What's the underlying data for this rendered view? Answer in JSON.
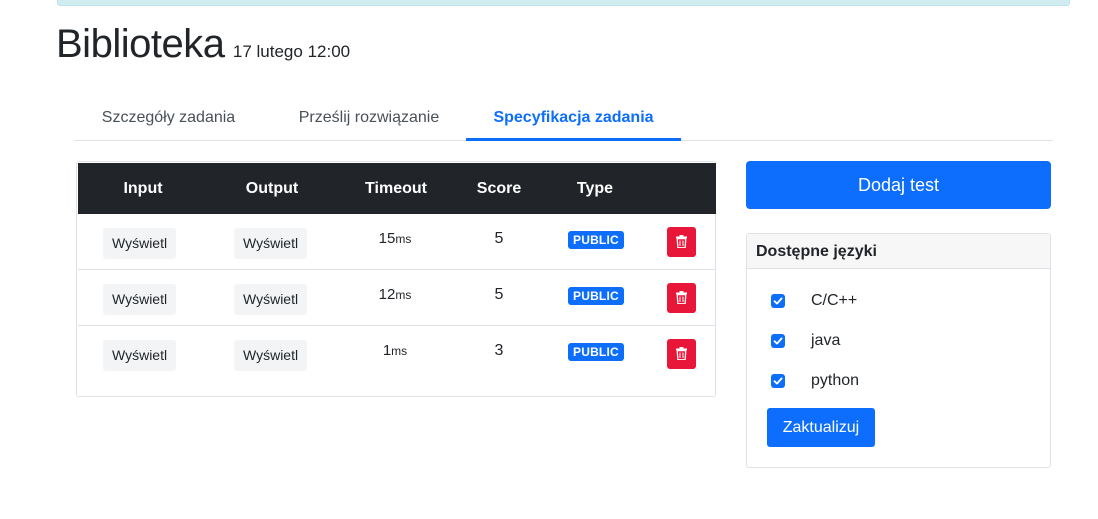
{
  "header": {
    "title": "Biblioteka",
    "date": "17 lutego 12:00"
  },
  "tabs": [
    {
      "label": "Szczegóły zadania",
      "active": false
    },
    {
      "label": "Prześlij rozwiązanie",
      "active": false
    },
    {
      "label": "Specyfikacja zadania",
      "active": true
    }
  ],
  "table": {
    "columns": [
      "Input",
      "Output",
      "Timeout",
      "Score",
      "Type"
    ],
    "rows": [
      {
        "input": "Wyświetl",
        "output": "Wyświetl",
        "timeout": "15",
        "unit": "ms",
        "score": "5",
        "type": "PUBLIC"
      },
      {
        "input": "Wyświetl",
        "output": "Wyświetl",
        "timeout": "12",
        "unit": "ms",
        "score": "5",
        "type": "PUBLIC"
      },
      {
        "input": "Wyświetl",
        "output": "Wyświetl",
        "timeout": "1",
        "unit": "ms",
        "score": "3",
        "type": "PUBLIC"
      }
    ]
  },
  "add_test_label": "Dodaj test",
  "languages": {
    "title": "Dostępne języki",
    "items": [
      {
        "label": "C/C++",
        "checked": true
      },
      {
        "label": "java",
        "checked": true
      },
      {
        "label": "python",
        "checked": true
      }
    ],
    "update_label": "Zaktualizuj"
  },
  "colors": {
    "primary": "#0d6efd",
    "danger": "#e8173a",
    "dark": "#212529",
    "info_bg": "#d1ecf1"
  },
  "icons": {
    "delete": "trash-icon",
    "check": "checkmark-icon"
  }
}
